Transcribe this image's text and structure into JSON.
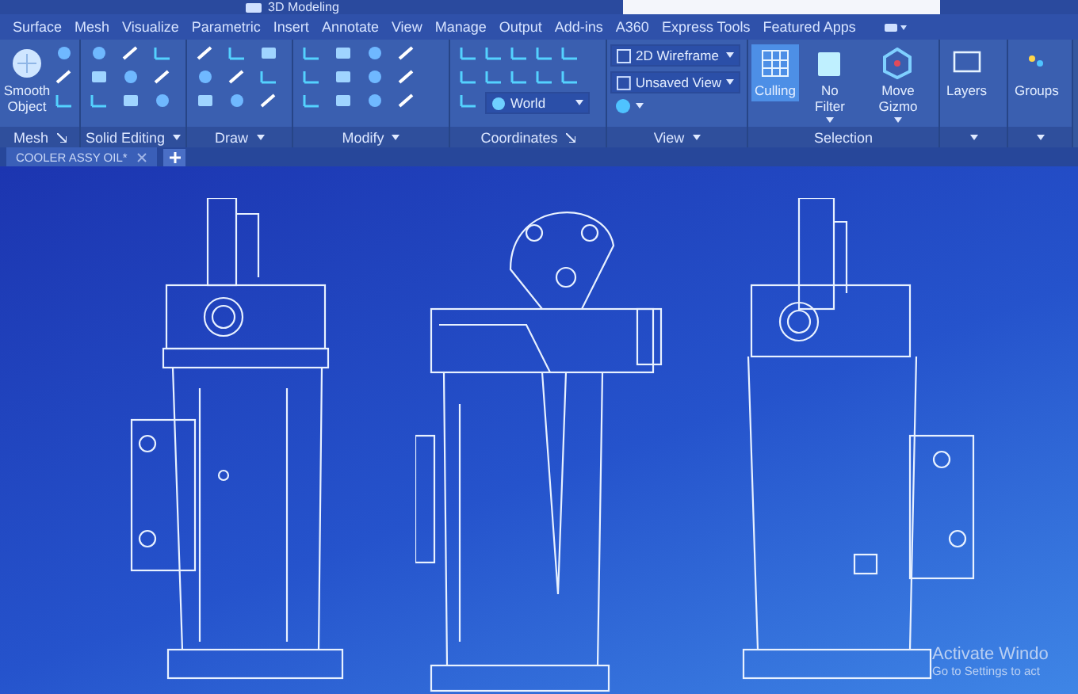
{
  "window": {
    "title": "3D Modeling"
  },
  "ribbon_tabs": [
    {
      "label": "Surface",
      "selected": false
    },
    {
      "label": "Mesh",
      "selected": false
    },
    {
      "label": "Visualize",
      "selected": false
    },
    {
      "label": "Parametric",
      "selected": false
    },
    {
      "label": "Insert",
      "selected": false
    },
    {
      "label": "Annotate",
      "selected": false
    },
    {
      "label": "View",
      "selected": false
    },
    {
      "label": "Manage",
      "selected": false
    },
    {
      "label": "Output",
      "selected": false
    },
    {
      "label": "Add-ins",
      "selected": false
    },
    {
      "label": "A360",
      "selected": false
    },
    {
      "label": "Express Tools",
      "selected": false
    },
    {
      "label": "Featured Apps",
      "selected": false
    }
  ],
  "panels": [
    {
      "title": "Mesh",
      "launcher": true,
      "kind": "mesh",
      "buttons": [
        {
          "label": "Smooth Object",
          "selected": false
        }
      ]
    },
    {
      "title": "Solid Editing",
      "menu": true,
      "kind": "icons"
    },
    {
      "title": "Draw",
      "menu": true,
      "kind": "icons"
    },
    {
      "title": "Modify",
      "menu": true,
      "kind": "icons"
    },
    {
      "title": "Coordinates",
      "launcher": true,
      "kind": "coords",
      "dropdown": "World"
    },
    {
      "title": "View",
      "menu": true,
      "kind": "view",
      "dropdowns": [
        "2D Wireframe",
        "Unsaved View"
      ]
    },
    {
      "title": "Selection",
      "kind": "big",
      "buttons": [
        {
          "label": "Culling",
          "selected": true
        },
        {
          "label": "No Filter",
          "selected": false
        },
        {
          "label": "Move Gizmo",
          "selected": false
        }
      ]
    },
    {
      "menu": true,
      "kind": "big",
      "buttons": [
        {
          "label": "Layers",
          "selected": false
        }
      ]
    },
    {
      "menu": true,
      "kind": "big",
      "buttons": [
        {
          "label": "Groups",
          "selected": false
        }
      ]
    }
  ],
  "document_tabs": [
    {
      "label": "COOLER ASSY OIL*",
      "selected": true
    }
  ],
  "activation_notice": {
    "title": "Activate Windo",
    "text": "Go to Settings to act"
  }
}
